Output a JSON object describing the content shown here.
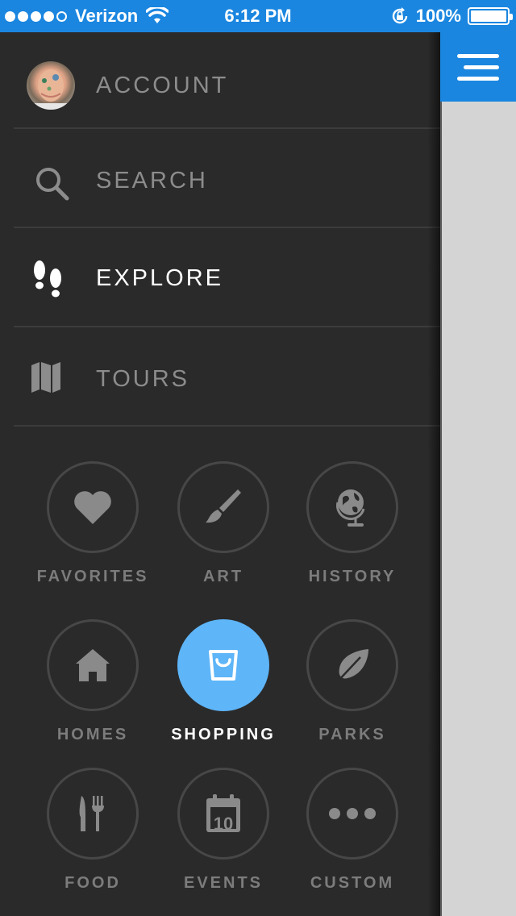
{
  "status_bar": {
    "carrier": "Verizon",
    "signal_bars_filled": 4,
    "signal_bars_total": 5,
    "time": "6:12 PM",
    "battery": "100%",
    "battery_level": 1.0
  },
  "menu": {
    "items": [
      {
        "label": "ACCOUNT",
        "icon": "avatar"
      },
      {
        "label": "SEARCH",
        "icon": "search-icon"
      },
      {
        "label": "EXPLORE",
        "icon": "footprints-icon",
        "active": true
      },
      {
        "label": "TOURS",
        "icon": "map-icon"
      }
    ]
  },
  "categories": [
    {
      "label": "FAVORITES",
      "icon": "heart-icon"
    },
    {
      "label": "ART",
      "icon": "paintbrush-icon"
    },
    {
      "label": "HISTORY",
      "icon": "globe-icon"
    },
    {
      "label": "HOMES",
      "icon": "house-icon"
    },
    {
      "label": "SHOPPING",
      "icon": "shopping-bag-icon",
      "active": true
    },
    {
      "label": "PARKS",
      "icon": "leaf-icon"
    },
    {
      "label": "FOOD",
      "icon": "fork-knife-icon"
    },
    {
      "label": "EVENTS",
      "icon": "calendar-icon",
      "day": "10"
    },
    {
      "label": "CUSTOM",
      "icon": "more-dots-icon"
    }
  ],
  "colors": {
    "accent_blue": "#1a86e0",
    "active_category": "#5eb5f8",
    "drawer_bg": "#2a2a2a",
    "inactive_text": "#8c8c8c"
  }
}
